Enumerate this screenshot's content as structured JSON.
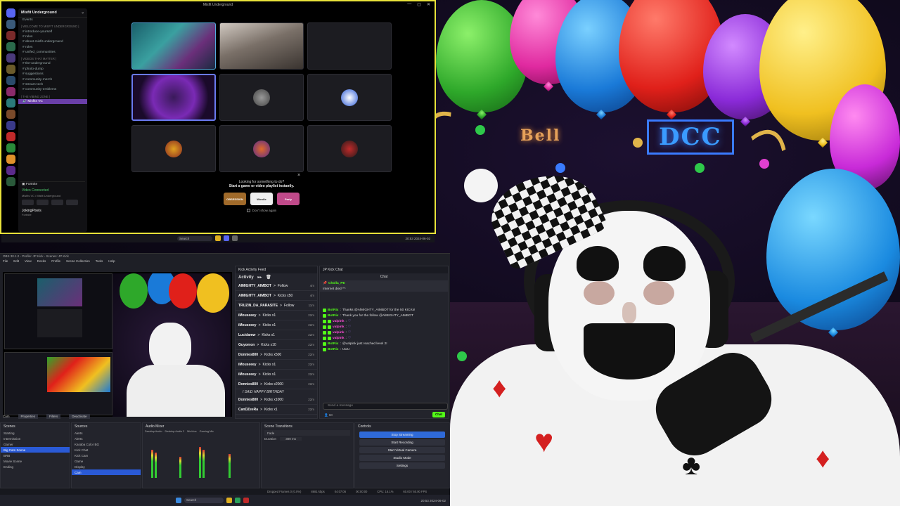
{
  "discord": {
    "window_title": "Misfit Underground",
    "server_name": "Misfit Underground",
    "events_label": "Events",
    "categories": [
      {
        "name": "| Welcome To Misfit Underground |",
        "channels": [
          "introduce-yourself",
          "rules",
          "about-misfit-underground",
          "roles",
          "unifed_communities"
        ]
      },
      {
        "name": "| Videos That Matter |",
        "channels": [
          "the-underground",
          "photo-dump",
          "suggestions",
          "community-merch",
          "stream-tech",
          "community-emblems"
        ]
      },
      {
        "name": "| The Vibing Zone |",
        "channels": [
          "Misfits VC"
        ]
      }
    ],
    "activity_game": "Fortnite",
    "voice_status": "Video Connected",
    "voice_sub": "Misfits VC / Misfit Underground",
    "user_name": "JokingPixels",
    "user_status": "Fortnite",
    "prompt_line1": "Looking for something to do?",
    "prompt_line2": "Start a game or video playlist instantly.",
    "activities": [
      "OBSESSION",
      "Wordle",
      "Party"
    ],
    "dont_show": "Don't show again",
    "close_glyph": "×"
  },
  "taskbar_top": {
    "search_placeholder": "Search",
    "clock": "20:53\n2024-06-02"
  },
  "obs": {
    "title": "OBS 30.1.2 - Profile: JP Kick - Scenes: JP Kick",
    "menu": [
      "File",
      "Edit",
      "View",
      "Docks",
      "Profile",
      "Scene Collection",
      "Tools",
      "Help"
    ],
    "activity_feed_title": "Kick Activity Feed",
    "activity_label": "Activity",
    "feed": [
      {
        "user": "AlMIGHTY_AIMBOT",
        "action": "Follow",
        "time": "4m"
      },
      {
        "user": "AlMIGHTY_AIMBOT",
        "action": "Kicks x50",
        "time": "4m"
      },
      {
        "user": "TRUZIN_DA_PARASITE",
        "action": "Follow",
        "time": "11m"
      },
      {
        "user": "iMouseeey",
        "action": "Kicks x1",
        "time": "22m"
      },
      {
        "user": "iMouseeey",
        "action": "Kicks x1",
        "time": "22m"
      },
      {
        "user": "Lucidamw",
        "action": "Kicks x1",
        "time": "22m"
      },
      {
        "user": "Guyomon",
        "action": "Kicks x10",
        "time": "22m"
      },
      {
        "user": "Donnies800",
        "action": "Kicks x500",
        "time": "22m"
      },
      {
        "user": "iMouseeey",
        "action": "Kicks x1",
        "time": "22m"
      },
      {
        "user": "iMouseeey",
        "action": "Kicks x1",
        "time": "22m"
      },
      {
        "user": "Donnies800",
        "action": "Kicks x2000",
        "time": "22m"
      },
      {
        "user": "Donnies800",
        "action": "Kicks x1000",
        "time": "22m"
      },
      {
        "user": "CanDZeeRa",
        "action": "Kicks x1",
        "time": "22m"
      }
    ],
    "feed_message": "I SAID HAPPY BIRTHDAY",
    "chat_dock_title": "JP Kick Chat",
    "chat_header": "Chat",
    "pinned_user": "Cholla_PE",
    "pinned_text": "Internet died ^^",
    "chat": [
      {
        "user": "BotRix",
        "text": "Thanks @AlMIGHTY_AIMBOT for the 50 KICKs!"
      },
      {
        "user": "BotRix",
        "text": "Thank you for the follow @AlMIGHTY_AIMBOT"
      },
      {
        "user": "valpink",
        "text": "♡"
      },
      {
        "user": "valpink",
        "text": "♡"
      },
      {
        "user": "valpink",
        "text": "♡"
      },
      {
        "user": "valpink",
        "text": "♡"
      },
      {
        "user": "BotRix",
        "text": "@valpink just reached level 2!"
      },
      {
        "user": "BotRix",
        "text": "UwU"
      }
    ],
    "chat_placeholder": "Send a message",
    "chat_send": "Chat",
    "chat_count": "60",
    "scene_label": "Cam",
    "tabs": [
      "Properties",
      "Filters",
      "Deactivate"
    ],
    "scenes_title": "Scenes",
    "scenes": [
      "Starting",
      "Intermission",
      "Gamer",
      "Big Cam Scene",
      "BRB",
      "Movie Scene",
      "Ending"
    ],
    "selected_scene_index": 3,
    "sources_title": "Sources",
    "sources": [
      "Alerts",
      "Alerts",
      "Kasaba Color BG",
      "Kick Chat",
      "Kick Cam",
      "Game",
      "Display",
      "Cam"
    ],
    "audio_title": "Audio Mixer",
    "audio_channels": [
      "Desktop Audio",
      "Desktop Audio 2",
      "Mic/Aux",
      "Gaming Mic"
    ],
    "transitions_title": "Scene Transitions",
    "transition": "Fade",
    "duration_label": "Duration",
    "duration": "300 ms",
    "controls_title": "Controls",
    "controls": [
      "Stop Streaming",
      "Start Recording",
      "Start Virtual Camera",
      "Studio Mode",
      "Settings"
    ],
    "status": [
      "Dropped Frames 0 (0.0%)",
      "8681 kbps",
      "04:07:06",
      "00:00:00",
      "CPU: 16.1%",
      "60.00 / 60.00 FPS"
    ]
  },
  "taskbar_bottom": {
    "search_placeholder": "Search",
    "clock": "20:53\n2024-06-02"
  },
  "colors": {
    "discord_border": "#e8e23a",
    "kick_green": "#53fc18",
    "obs_blue": "#2f6ad8"
  }
}
